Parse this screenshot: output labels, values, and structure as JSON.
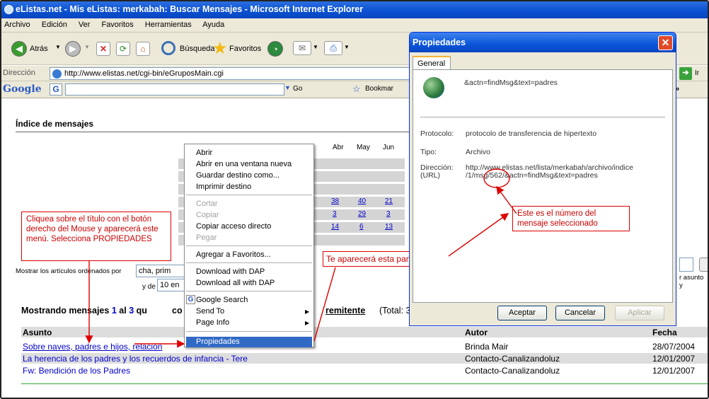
{
  "window": {
    "title": "eListas.net - Mis eListas: merkabah: Buscar Mensajes - Microsoft Internet Explorer"
  },
  "menubar": [
    "Archivo",
    "Edición",
    "Ver",
    "Favoritos",
    "Herramientas",
    "Ayuda"
  ],
  "toolbar": {
    "back": "Atrás",
    "search": "Búsqueda",
    "favorites": "Favoritos"
  },
  "addressbar": {
    "label": "Dirección",
    "url": "http://www.elistas.net/cgi-bin/eGruposMain.cgi",
    "go": "Ir"
  },
  "googlebar": {
    "logo": "Google",
    "go": "Go",
    "bookmarks": "Bookmar"
  },
  "page": {
    "heading": "Índice de mensajes",
    "months": [
      "Abr",
      "May",
      "Jun"
    ],
    "calendar_rows": [
      [
        "38",
        "40",
        "21"
      ],
      [
        "3",
        "29",
        "3"
      ],
      [
        "14",
        "6",
        "13"
      ]
    ],
    "sort_label": "Mostrar los artículos ordenados por",
    "sort_value": "cha, prim",
    "y_de": "y de",
    "y_de_value": "10 en",
    "right_hint": "r asunto y",
    "showing_prefix": "Mostrando mensajes",
    "showing_1": "1",
    "showing_al": "al",
    "showing_3": "3",
    "showing_qu": "qu",
    "showing_co": "co",
    "showing_rem": "remitente",
    "showing_total": "(Total: 3)",
    "table_headers": [
      "Asunto",
      "Autor",
      "Fecha"
    ],
    "rows": [
      {
        "subject": "Sobre naves, padres e hijos, relación",
        "author": "Brinda Mair",
        "date": "28/07/2004"
      },
      {
        "subject": "La herencia de los padres y los recuerdos de infancia - Tere",
        "author": "Contacto-Canalizandoluz",
        "date": "12/01/2007"
      },
      {
        "subject": "Fw: Bendición de los Padres",
        "author": "Contacto-Canalizandoluz",
        "date": "12/01/2007"
      }
    ]
  },
  "context_menu": {
    "items": [
      "Abrir",
      "Abrir en una ventana nueva",
      "Guardar destino como...",
      "Imprimir destino",
      "Cortar",
      "Copiar",
      "Copiar acceso directo",
      "Pegar",
      "Agregar a Favoritos...",
      "Download with DAP",
      "Download all with DAP",
      "Google Search",
      "Send To",
      "Page Info",
      "Propiedades"
    ]
  },
  "dialog": {
    "title": "Propiedades",
    "tab": "General",
    "name": "&actn=findMsg&text=padres",
    "protocol_label": "Protocolo:",
    "protocol_value": "protocolo de transferencia de hipertexto",
    "type_label": "Tipo:",
    "type_value": "Archivo",
    "address_label": "Dirección:",
    "url_label": "(URL)",
    "address_line1": "http://www.elistas.net/lista/merkabah/archivo/indice",
    "address_line2": "/1/msg/562/&actn=findMsg&text=padres",
    "ok": "Aceptar",
    "cancel": "Cancelar",
    "apply": "Aplicar"
  },
  "annotations": {
    "callout_1": "Cliquea sobre el título con el botón derecho del Mouse y aparecerá este menú. Selecciona PROPIEDADES",
    "callout_2": "Te aparecerá esta pantalla",
    "callout_3": "Este es el número del mensaje seleccionado"
  },
  "colors": {
    "annotation": "#dd0000",
    "xp_blue": "#0a4fd0",
    "link": "#0000cc"
  }
}
